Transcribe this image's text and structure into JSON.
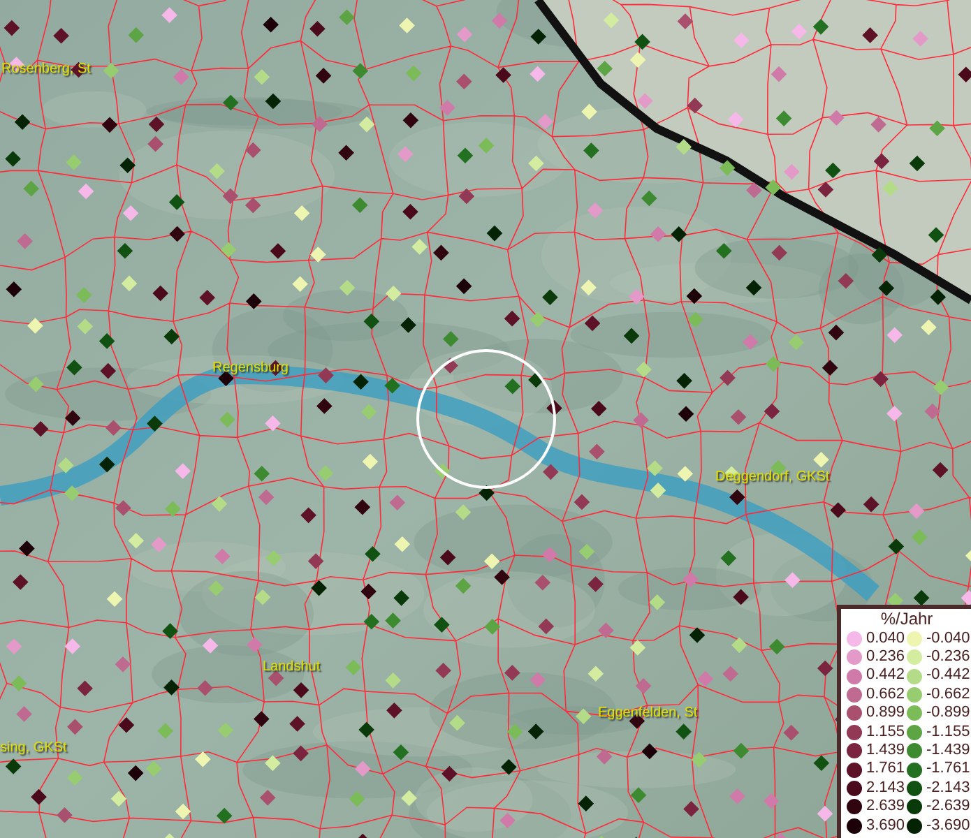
{
  "map": {
    "places": [
      {
        "name": "Rosenberg, St"
      },
      {
        "name": "Regensburg"
      },
      {
        "name": "Deggendorf, GKSt"
      },
      {
        "name": "Landshut"
      },
      {
        "name": "sing, GKSt"
      },
      {
        "name": "Eggenfelden, St"
      }
    ]
  },
  "legend": {
    "title": "%/Jahr",
    "positive": [
      {
        "label": "0.040",
        "color": "#f5b8e8"
      },
      {
        "label": "0.236",
        "color": "#e39ac9"
      },
      {
        "label": "0.442",
        "color": "#cf7aa8"
      },
      {
        "label": "0.662",
        "color": "#bf6a90"
      },
      {
        "label": "0.899",
        "color": "#a8506e"
      },
      {
        "label": "1.155",
        "color": "#923a55"
      },
      {
        "label": "1.439",
        "color": "#7a2440"
      },
      {
        "label": "1.761",
        "color": "#5e1228"
      },
      {
        "label": "2.143",
        "color": "#4a0a1c"
      },
      {
        "label": "2.639",
        "color": "#300510"
      },
      {
        "label": "3.690",
        "color": "#1c0208"
      }
    ],
    "negative": [
      {
        "label": "-0.040",
        "color": "#eef5b0"
      },
      {
        "label": "-0.236",
        "color": "#d4eca0"
      },
      {
        "label": "-0.442",
        "color": "#b4dc88"
      },
      {
        "label": "-0.662",
        "color": "#98cc70"
      },
      {
        "label": "-0.899",
        "color": "#7bbb58"
      },
      {
        "label": "-1.155",
        "color": "#5ca444"
      },
      {
        "label": "-1.439",
        "color": "#3e8a30"
      },
      {
        "label": "-1.761",
        "color": "#237020"
      },
      {
        "label": "-2.143",
        "color": "#115212"
      },
      {
        "label": "-2.639",
        "color": "#0a3a0a"
      },
      {
        "label": "-3.690",
        "color": "#042204"
      }
    ]
  }
}
